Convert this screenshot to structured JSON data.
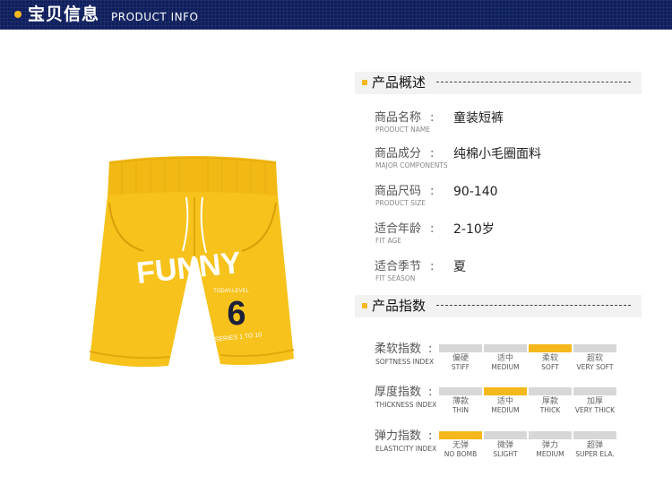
{
  "header": {
    "title_cn": "宝贝信息",
    "title_en": "PRODUCT INFO"
  },
  "product_image": {
    "text_brand": "FUNNY",
    "text_small": "TODAY.LEVEL",
    "text_number": "6",
    "text_series": "SERIES 1 TO 10"
  },
  "overview": {
    "title": "产品概述",
    "rows": [
      {
        "cn": "商品名称",
        "en": "PRODUCT NAME",
        "value": "童装短裤"
      },
      {
        "cn": "商品成分",
        "en": "MAJOR COMPONENTS",
        "value": "纯棉小毛圈面料"
      },
      {
        "cn": "商品尺码",
        "en": "PRODUCT SIZE",
        "value": "90-140"
      },
      {
        "cn": "适合年龄",
        "en": "FIT AGE",
        "value": "2-10岁"
      },
      {
        "cn": "适合季节",
        "en": "FIT SEASON",
        "value": "夏"
      }
    ]
  },
  "index": {
    "title": "产品指数",
    "rows": [
      {
        "cn": "柔软指数",
        "en": "SOFTNESS INDEX",
        "selected": 2,
        "options": [
          {
            "c": "偏硬",
            "e": "STIFF"
          },
          {
            "c": "适中",
            "e": "MEDIUM"
          },
          {
            "c": "柔软",
            "e": "SOFT"
          },
          {
            "c": "超软",
            "e": "VERY SOFT"
          }
        ]
      },
      {
        "cn": "厚度指数",
        "en": "THICKNESS INDEX",
        "selected": 1,
        "options": [
          {
            "c": "薄款",
            "e": "THIN"
          },
          {
            "c": "适中",
            "e": "MEDIUM"
          },
          {
            "c": "厚款",
            "e": "THICK"
          },
          {
            "c": "加厚",
            "e": "VERY THICK"
          }
        ]
      },
      {
        "cn": "弹力指数",
        "en": "ELASTICITY INDEX",
        "selected": 0,
        "options": [
          {
            "c": "无弹",
            "e": "NO BOMB"
          },
          {
            "c": "微弹",
            "e": "SLIGHT"
          },
          {
            "c": "弹力",
            "e": "MEDIUM"
          },
          {
            "c": "超弹",
            "e": "SUPER ELA."
          }
        ]
      }
    ]
  },
  "colors": {
    "accent": "#f5b81c",
    "header_bg": "#0f1f5e",
    "inactive": "#d7d7d7",
    "shorts": "#f6c21b"
  },
  "separator": ":",
  "dashes": "- - - - - - - - - - - - - - - -"
}
